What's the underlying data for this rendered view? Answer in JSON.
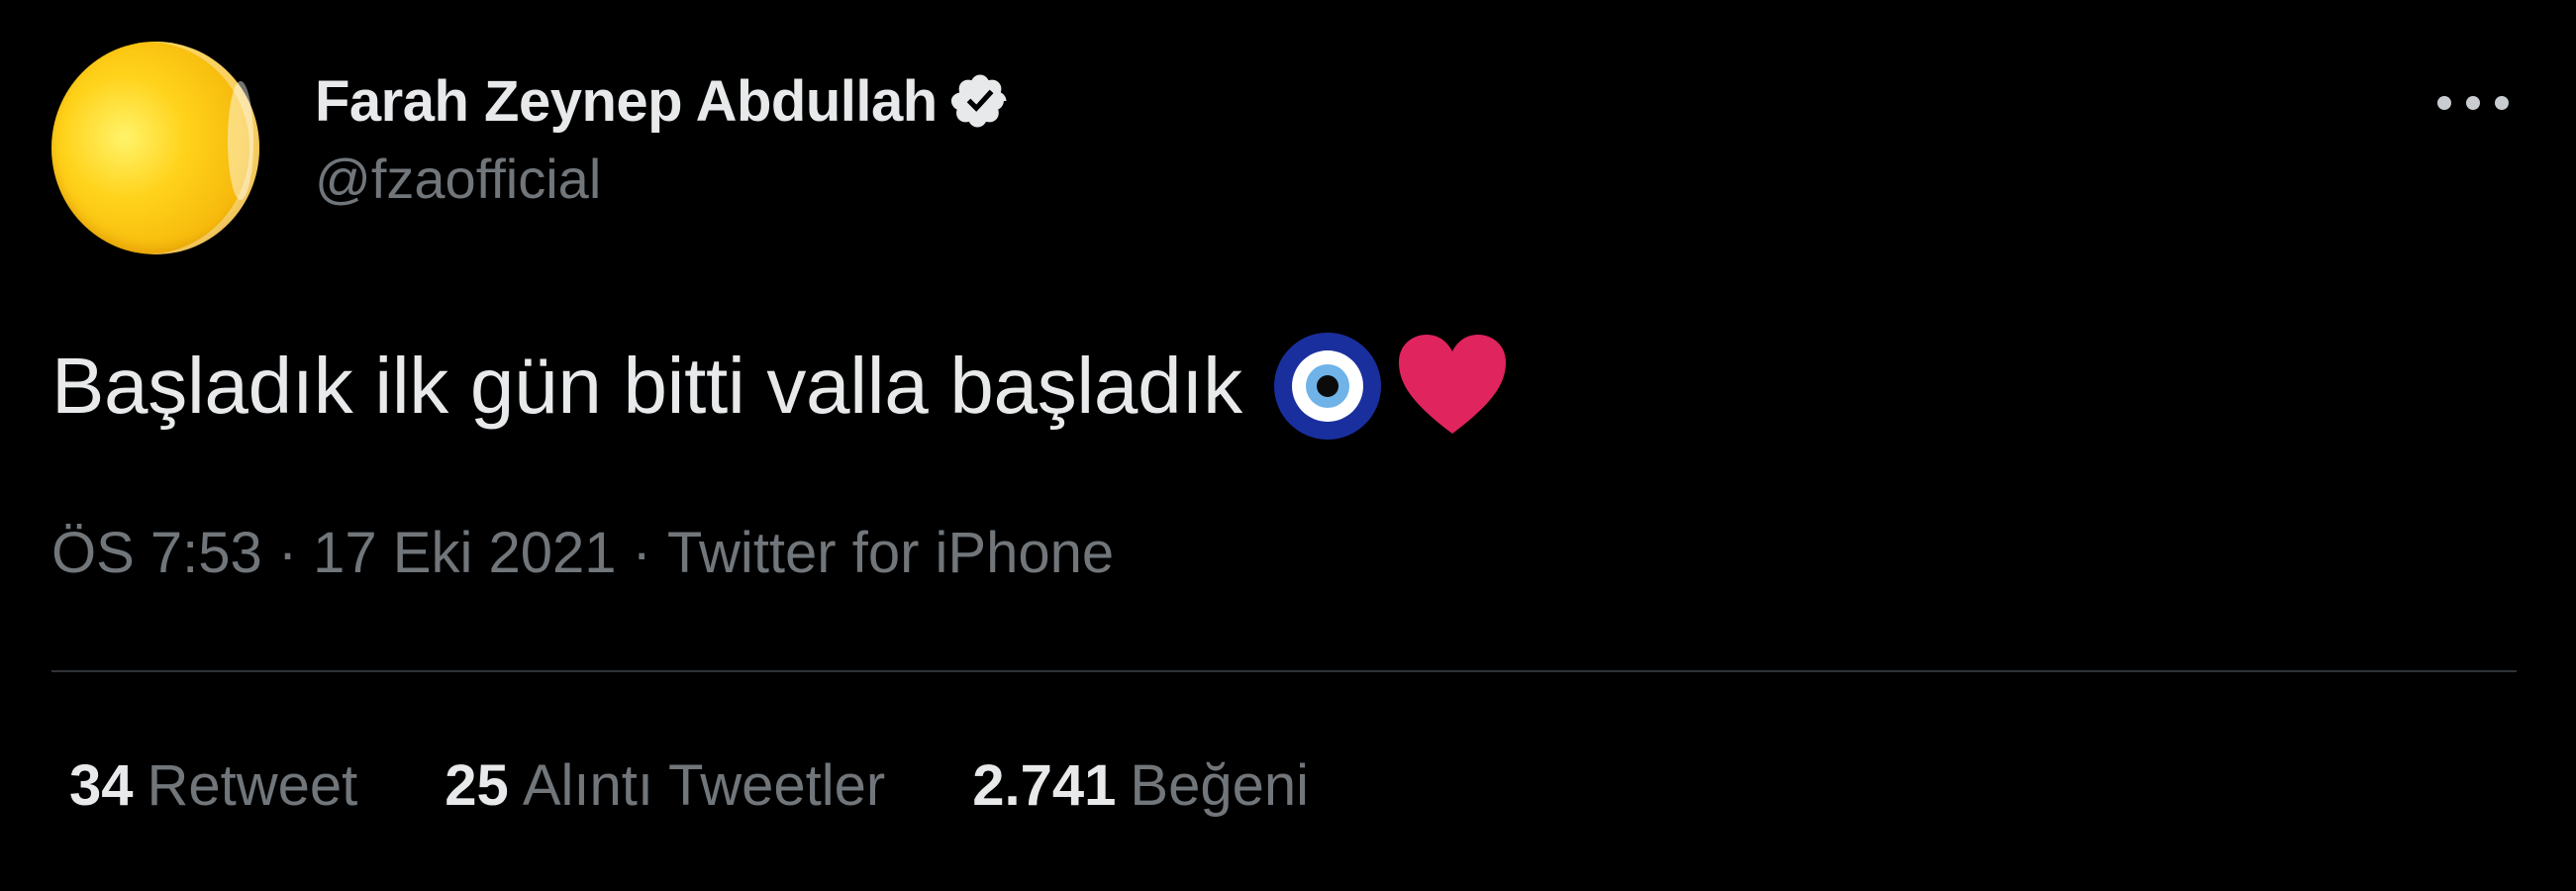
{
  "author": {
    "display_name": "Farah Zeynep Abdullah",
    "handle": "@fzaofficial",
    "verified_icon": "verified-badge-icon",
    "avatar_color": "#ffd21a"
  },
  "tweet": {
    "text": "Başladık ilk gün bitti valla başladık",
    "emojis": [
      "nazar-amulet-icon",
      "red-heart-icon"
    ]
  },
  "meta": {
    "time": "ÖS 7:53",
    "separator": "·",
    "date": "17 Eki 2021",
    "source": "Twitter for iPhone"
  },
  "stats": [
    {
      "count": "34",
      "label": "Retweet"
    },
    {
      "count": "25",
      "label": "Alıntı Tweetler"
    },
    {
      "count": "2.741",
      "label": "Beğeni"
    }
  ],
  "colors": {
    "background": "#000000",
    "primary_text": "#e7e9ea",
    "secondary_text": "#71767b",
    "divider": "#2f3336",
    "heart": "#e0245e"
  }
}
